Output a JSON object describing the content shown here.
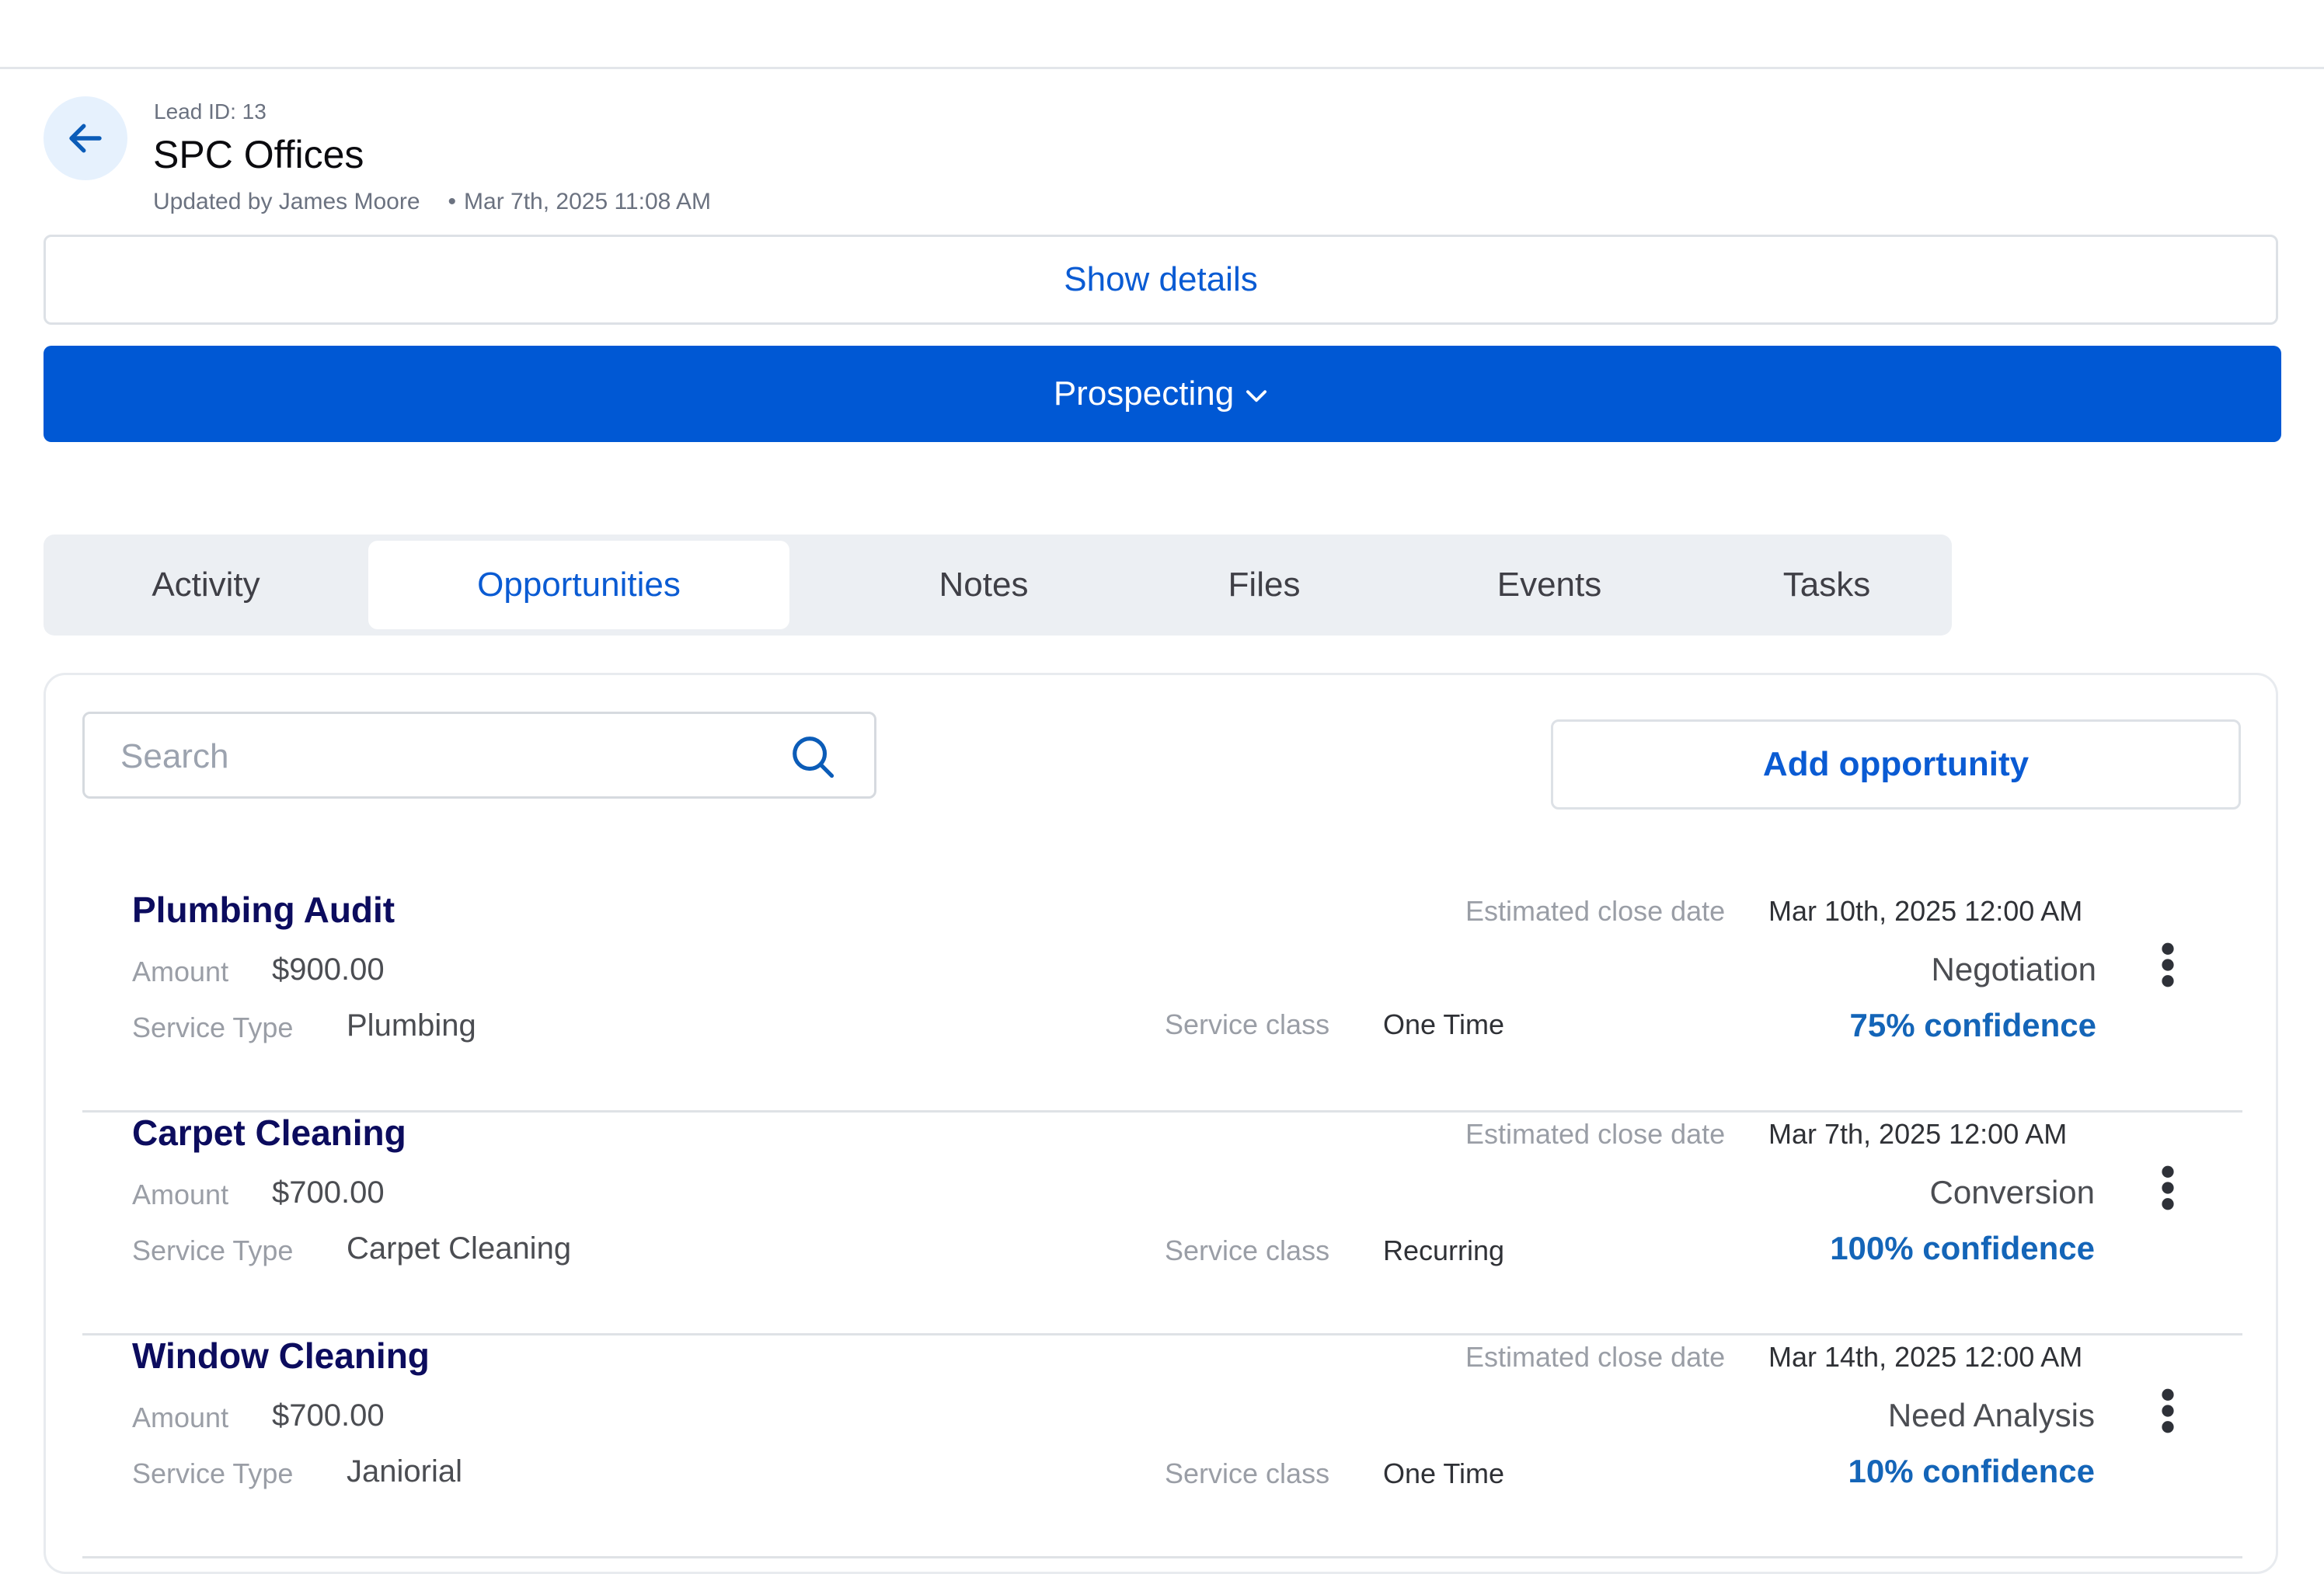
{
  "lead": {
    "id_label": "Lead ID: 13",
    "title": "SPC Offices",
    "updated_by": "Updated by James Moore",
    "updated_at": "Mar 7th, 2025 11:08 AM"
  },
  "show_details_label": "Show details",
  "stage_label": "Prospecting",
  "tabs": [
    {
      "label": "Activity"
    },
    {
      "label": "Opportunities",
      "active": true
    },
    {
      "label": "Notes"
    },
    {
      "label": "Files"
    },
    {
      "label": "Events"
    },
    {
      "label": "Tasks"
    }
  ],
  "search": {
    "placeholder": "Search",
    "value": ""
  },
  "add_opportunity_label": "Add opportunity",
  "labels": {
    "amount": "Amount",
    "service_type": "Service Type",
    "service_class": "Service class",
    "estimated_close_date": "Estimated close date"
  },
  "opportunities": [
    {
      "title": "Plumbing Audit",
      "amount": "$900.00",
      "service_type": "Plumbing",
      "service_class": "One Time",
      "close_date": "Mar 10th, 2025 12:00 AM",
      "stage": "Negotiation",
      "confidence": "75% confidence"
    },
    {
      "title": "Carpet Cleaning",
      "amount": "$700.00",
      "service_type": "Carpet Cleaning",
      "service_class": "Recurring",
      "close_date": "Mar 7th, 2025 12:00 AM",
      "stage": "Conversion",
      "confidence": "100% confidence"
    },
    {
      "title": "Window Cleaning",
      "amount": "$700.00",
      "service_type": "Janiorial",
      "service_class": "One Time",
      "close_date": "Mar 14th, 2025 12:00 AM",
      "stage": "Need Analysis",
      "confidence": "10% confidence"
    }
  ],
  "colors": {
    "primary": "#0058d4",
    "link": "#0a5bd3",
    "title": "#0c0c5e",
    "confidence": "#1465b8"
  },
  "icons": {
    "back": "arrow-left-icon",
    "chevron": "chevron-down-icon",
    "search": "search-icon",
    "more": "more-vertical-icon"
  }
}
